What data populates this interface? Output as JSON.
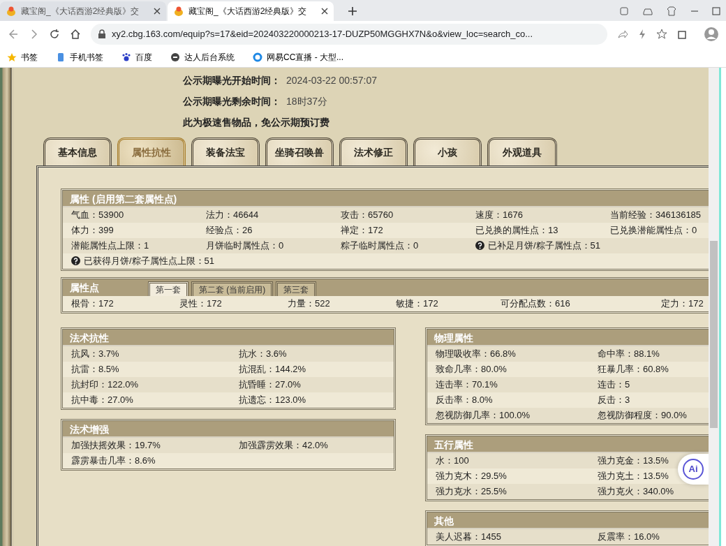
{
  "browser": {
    "tabs": [
      {
        "title": "藏宝阁_《大话西游2经典版》交",
        "selected": false
      },
      {
        "title": "藏宝阁_《大话西游2经典版》交",
        "selected": true
      }
    ],
    "url": "xy2.cbg.163.com/equip?s=17&eid=202403220000213-17-DUZP50MGGHX7N&o&view_loc=search_co...",
    "bookmarks": [
      {
        "label": "书签",
        "kind": "star"
      },
      {
        "label": "手机书签",
        "kind": "phone"
      },
      {
        "label": "百度",
        "kind": "paw"
      },
      {
        "label": "达人后台系统",
        "kind": "circle"
      },
      {
        "label": "网易CC直播 - 大型...",
        "kind": "ring"
      }
    ]
  },
  "notice": [
    {
      "label": "公示期曝光开始时间：",
      "value": "2024-03-22 00:57:07"
    },
    {
      "label": "公示期曝光剩余时间：",
      "value": "18时37分"
    },
    {
      "label": "此为极速售物品，免公示期预订费"
    }
  ],
  "nav_tabs": [
    {
      "label": "基本信息",
      "selected": false
    },
    {
      "label": "属性抗性",
      "selected": true
    },
    {
      "label": "装备法宝",
      "selected": false
    },
    {
      "label": "坐骑召唤兽",
      "selected": false
    },
    {
      "label": "法术修正",
      "selected": false
    },
    {
      "label": "小孩",
      "selected": false
    },
    {
      "label": "外观道具",
      "selected": false
    }
  ],
  "attributes": {
    "title": "属性 (启用第二套属性点)",
    "rows": [
      [
        {
          "text": "气血：53900",
          "help": false
        },
        {
          "text": "法力：46644",
          "help": false
        },
        {
          "text": "攻击：65760",
          "help": false
        },
        {
          "text": "速度：1676",
          "help": false
        },
        {
          "text": "当前经验：346136185",
          "help": false
        }
      ],
      [
        {
          "text": "体力：399",
          "help": false
        },
        {
          "text": "经验点：26",
          "help": false
        },
        {
          "text": "禅定：172",
          "help": false
        },
        {
          "text": "已兑换的属性点：13",
          "help": false
        },
        {
          "text": "已兑换潜能属性点：0",
          "help": false
        }
      ],
      [
        {
          "text": "潜能属性点上限：1",
          "help": false
        },
        {
          "text": "月饼临时属性点：0",
          "help": false
        },
        {
          "text": "粽子临时属性点：0",
          "help": false
        },
        {
          "text": "已补足月饼/粽子属性点：51",
          "help": true
        }
      ],
      [
        {
          "text": "已获得月饼/粽子属性点上限：51",
          "help": true
        }
      ]
    ]
  },
  "points": {
    "title": "属性点",
    "sets": [
      {
        "label": "第一套",
        "selected": true
      },
      {
        "label": "第二套 (当前启用)",
        "selected": false
      },
      {
        "label": "第三套",
        "selected": false
      }
    ],
    "values": [
      "根骨：172",
      "灵性：172",
      "力量：522",
      "敏捷：172",
      "可分配点数：616",
      "定力：172"
    ]
  },
  "left_sections": [
    {
      "title": "法术抗性",
      "rows": [
        [
          "抗风：3.7%",
          "抗水：3.6%"
        ],
        [
          "抗雷：8.5%",
          "抗混乱：144.2%"
        ],
        [
          "抗封印：122.0%",
          "抗昏睡：27.0%"
        ],
        [
          "抗中毒：27.0%",
          "抗遗忘：123.0%"
        ]
      ]
    },
    {
      "title": "法术增强",
      "rows": [
        [
          "加强扶摇效果：19.7%",
          "加强霹雳效果：42.0%"
        ],
        [
          "霹雳暴击几率：8.6%"
        ]
      ]
    }
  ],
  "right_sections": [
    {
      "title": "物理属性",
      "rows": [
        [
          "物理吸收率：66.8%",
          "命中率：88.1%"
        ],
        [
          "致命几率：80.0%",
          "狂暴几率：60.8%"
        ],
        [
          "连击率：70.1%",
          "连击：5"
        ],
        [
          "反击率：8.0%",
          "反击：3"
        ],
        [
          "忽视防御几率：100.0%",
          "忽视防御程度：90.0%"
        ]
      ]
    },
    {
      "title": "五行属性",
      "rows": [
        [
          "水：100",
          "强力克金：13.5%"
        ],
        [
          "强力克木：29.5%",
          "强力克土：13.5%"
        ],
        [
          "强力克水：25.5%",
          "强力克火：340.0%"
        ]
      ]
    },
    {
      "title": "其他",
      "rows": [
        [
          "美人迟暮：1455",
          "反震率：16.0%"
        ]
      ]
    }
  ],
  "floating_button": "Ai"
}
